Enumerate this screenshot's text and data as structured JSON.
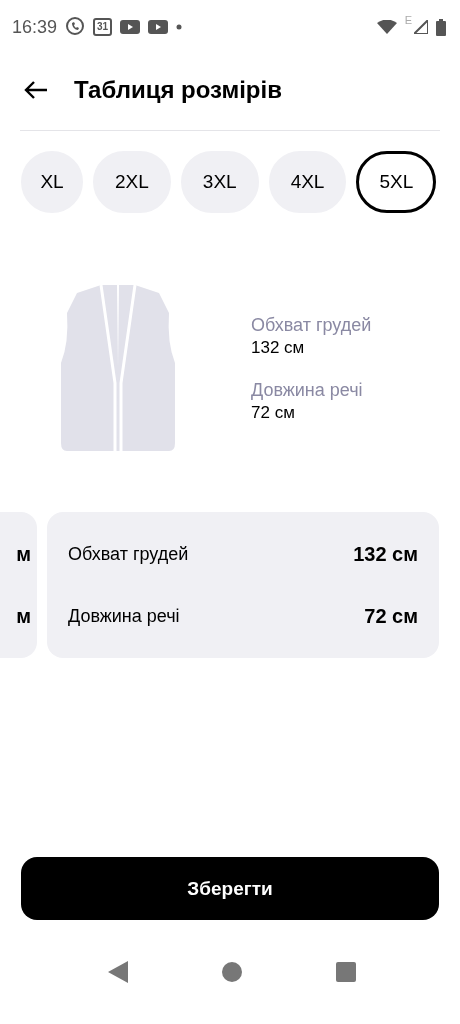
{
  "status_bar": {
    "time": "16:39",
    "calendar_day": "31",
    "network_type": "E"
  },
  "header": {
    "title": "Таблиця розмірів"
  },
  "sizes": [
    {
      "label": "XL",
      "selected": false
    },
    {
      "label": "2XL",
      "selected": false
    },
    {
      "label": "3XL",
      "selected": false
    },
    {
      "label": "4XL",
      "selected": false
    },
    {
      "label": "5XL",
      "selected": true
    }
  ],
  "measurements": [
    {
      "label": "Обхват грудей",
      "value": "132 см"
    },
    {
      "label": "Довжина речі",
      "value": "72 см"
    }
  ],
  "cards": [
    {
      "rows": [
        {
          "value": "м"
        },
        {
          "value": "м"
        }
      ]
    },
    {
      "rows": [
        {
          "label": "Обхват грудей",
          "value": "132 см"
        },
        {
          "label": "Довжина речі",
          "value": "72 см"
        }
      ]
    }
  ],
  "save_button": "Зберегти"
}
